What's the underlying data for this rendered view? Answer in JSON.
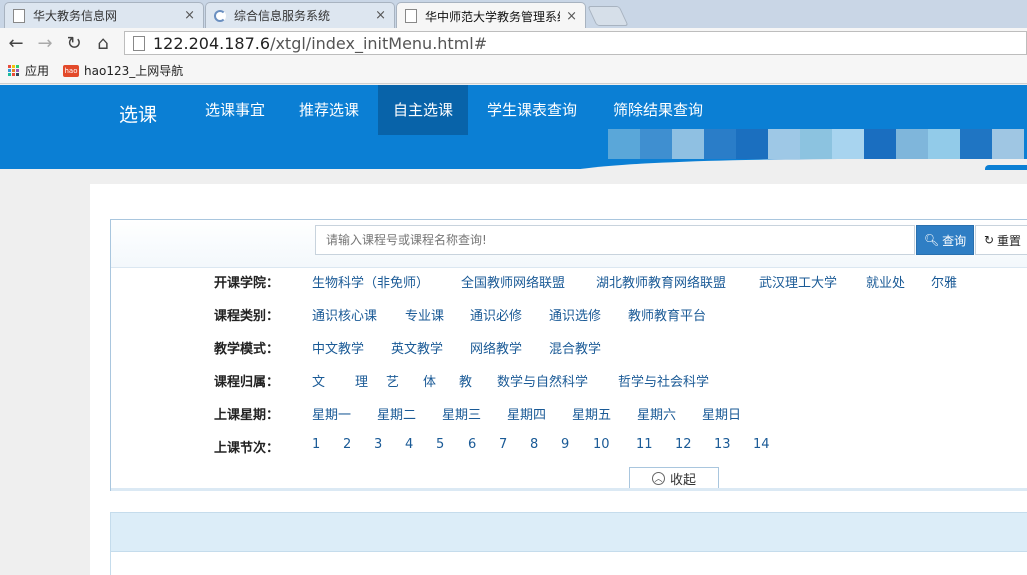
{
  "browser": {
    "tabs": [
      {
        "title": "华大教务信息网",
        "close": "×"
      },
      {
        "title": "综合信息服务系统",
        "close": "×"
      },
      {
        "title": "华中师范大学教务管理系统",
        "close": "×"
      }
    ],
    "nav": {
      "back": "←",
      "forward": "→",
      "reload": "↻",
      "home": "⌂"
    },
    "url": {
      "host": "122.204.187.6",
      "path": "/xtgl/index_initMenu.html#"
    },
    "bookmarks": [
      {
        "label": "应用",
        "icon": "apps-grid-icon"
      },
      {
        "label": "hao123_上网导航",
        "icon": "hao123-icon"
      }
    ]
  },
  "header": {
    "brand": "选课",
    "nav": [
      "选课事宜",
      "推荐选课",
      "自主选课",
      "学生课表查询",
      "筛除结果查询"
    ],
    "active_nav": "自主选课",
    "colors": {
      "bar": "#0b7fd4",
      "active": "#0863a9"
    },
    "mosaic_colors": [
      "#5aa7d9",
      "#3f8fd0",
      "#8fc0e2",
      "#2a7dc8",
      "#1b6fbf",
      "#9ec8e6",
      "#8cc3e0",
      "#a8d4ef",
      "#1a6ec0",
      "#7fb6db",
      "#92cbe9",
      "#1f75c3",
      "#9fc6e3"
    ]
  },
  "search": {
    "placeholder": "请输入课程号或课程名称查询!",
    "search_label": "查询",
    "reset_label": "重置"
  },
  "filters": [
    {
      "label": "开课学院：",
      "options": [
        "生物科学（非免师）",
        "全国教师网络联盟",
        "湖北教师教育网络联盟",
        "武汉理工大学",
        "就业处",
        "尔雅"
      ]
    },
    {
      "label": "课程类别：",
      "options": [
        "通识核心课",
        "专业课",
        "通识必修",
        "通识选修",
        "教师教育平台"
      ]
    },
    {
      "label": "教学模式：",
      "options": [
        "中文教学",
        "英文教学",
        "网络教学",
        "混合教学"
      ]
    },
    {
      "label": "课程归属：",
      "options": [
        "文",
        "理",
        "艺",
        "体",
        "教",
        "数学与自然科学",
        "哲学与社会科学"
      ]
    },
    {
      "label": "上课星期：",
      "options": [
        "星期一",
        "星期二",
        "星期三",
        "星期四",
        "星期五",
        "星期六",
        "星期日"
      ]
    },
    {
      "label": "上课节次：",
      "options": [
        "1",
        "2",
        "3",
        "4",
        "5",
        "6",
        "7",
        "8",
        "9",
        "10",
        "11",
        "12",
        "13",
        "14"
      ]
    }
  ],
  "collapse_label": "收起"
}
